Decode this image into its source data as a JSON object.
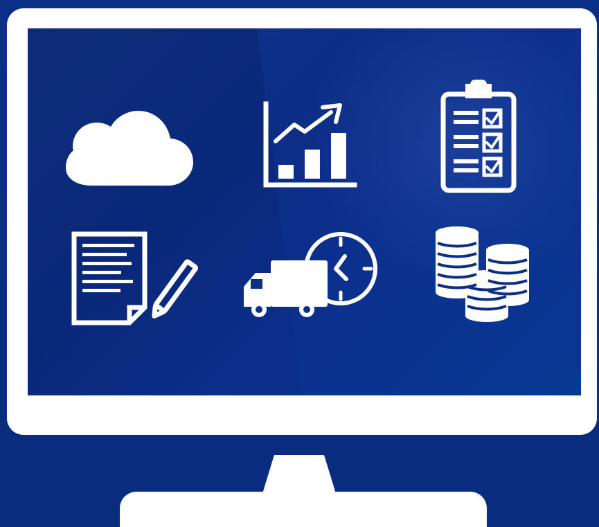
{
  "colors": {
    "background": "#0a2f86",
    "screen": "#0c2f86",
    "icon": "#ffffff",
    "monitor": "#ffffff"
  },
  "icons": [
    "cloud-icon",
    "growth-chart-icon",
    "checklist-icon",
    "document-edit-icon",
    "delivery-timer-icon",
    "coins-icon"
  ]
}
